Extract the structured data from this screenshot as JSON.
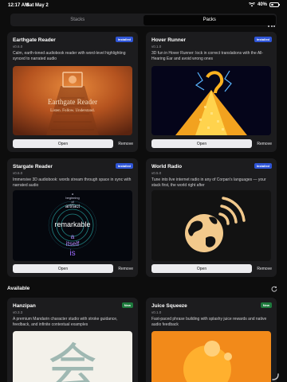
{
  "status_bar": {
    "time": "12:17 AM",
    "date": "Sat May 2",
    "battery": "40%",
    "battery_level": 0.4
  },
  "tabs": [
    {
      "label": "Stacks",
      "active": false
    },
    {
      "label": "Packs",
      "active": true
    }
  ],
  "cards": [
    {
      "title": "Earthgate Reader",
      "version": "v0.6.0",
      "badge": "Installed",
      "description": "Calm, earth-toned audiobook reader with word-level highlighting synced to narrated audio",
      "thumb_title": "Earthgate Reader",
      "thumb_subtitle": "Listen. Follow. Understand.",
      "open_label": "Open",
      "remove_label": "Remove"
    },
    {
      "title": "Hover Runner",
      "version": "v0.1.0",
      "badge": "Installed",
      "description": "3D fun in Hover Runner: lock in correct translations with the All-Hearing Ear and avoid wrong ones",
      "open_label": "Open",
      "remove_label": "Remove"
    },
    {
      "title": "Stargate Reader",
      "version": "v0.6.0",
      "badge": "Installed",
      "description": "Immersive 3D audiobook: words stream through space in sync with narrated audio",
      "thumb_words": {
        "top": "a",
        "beginning": "beginning",
        "of": "of",
        "artifact": "artifact",
        "main": "remarkable",
        "a2": "a",
        "itself": "itself",
        "is": "is"
      },
      "open_label": "Open",
      "remove_label": "Remove"
    },
    {
      "title": "World Radio",
      "version": "v0.5.0",
      "badge": "Installed",
      "description": "Tune into live internet radio in any of Corpan's languages — your stack first, the world right after",
      "open_label": "Open",
      "remove_label": "Remove"
    }
  ],
  "available_section": {
    "label": "Available",
    "cards": [
      {
        "title": "Hanzipan",
        "version": "v0.3.3",
        "badge": "New",
        "description": "A premium Mandarin character studio with stroke guidance, feedback, and infinite contextual examples",
        "thumb_char": "会"
      },
      {
        "title": "Juice Squeeze",
        "version": "v0.1.0",
        "badge": "New",
        "description": "Fast-paced phrase building with splashy juice rewards and native audio feedback"
      }
    ]
  },
  "icons": {
    "wifi": "wifi-icon",
    "battery": "battery-icon",
    "more": "more-dots-icon",
    "refresh": "refresh-icon",
    "resize": "window-resize-icon"
  },
  "colors": {
    "background": "#0d0d0d",
    "card": "#1c1c1e",
    "installed_badge": "#2f55d6",
    "new_badge": "#1e7a3d",
    "open_button": "#ececef"
  }
}
